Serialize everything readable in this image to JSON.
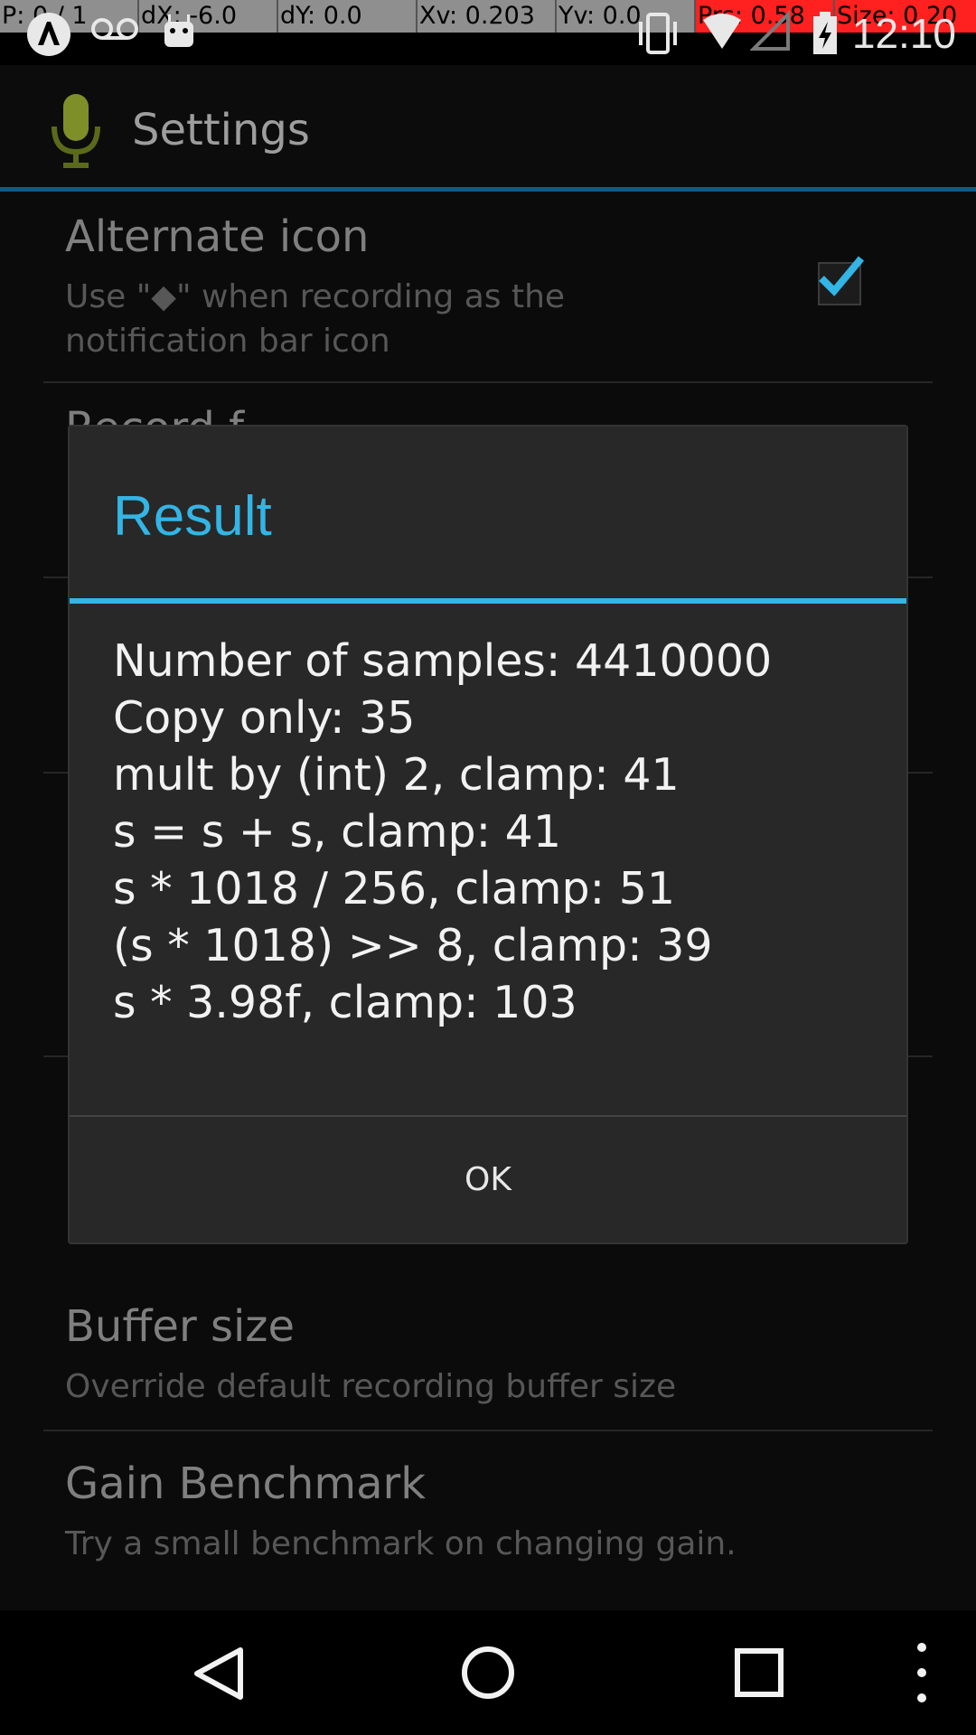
{
  "pointer_overlay": {
    "p": "P: 0 / 1",
    "dx": "dX: -6.0",
    "dy": "dY: 0.0",
    "xv": "Xv: 0.203",
    "yv": "Yv: 0.0",
    "prs": "Prs: 0.58",
    "size": "Size: 0.20"
  },
  "status_bar": {
    "clock": "12:10",
    "icons": [
      "app-notification-icon",
      "voicemail-icon",
      "android-icon",
      "vibrate-icon",
      "wifi-icon",
      "signal-icon",
      "battery-charging-icon"
    ]
  },
  "action_bar": {
    "title": "Settings",
    "icon": "microphone-icon"
  },
  "settings": {
    "alternate_icon": {
      "title": "Alternate icon",
      "summary": "Use \"◆\" when recording as the notification bar icon",
      "checked": true
    },
    "partial_title": "Record f",
    "buffer_size": {
      "title": "Buffer size",
      "summary": "Override default recording buffer size"
    },
    "gain_benchmark": {
      "title": "Gain Benchmark",
      "summary": "Try a small benchmark on changing gain."
    }
  },
  "dialog": {
    "title": "Result",
    "lines": [
      "Number of samples: 4410000",
      "Copy only: 35",
      "mult by (int) 2, clamp: 41",
      "s = s + s, clamp: 41",
      "s * 1018 / 256, clamp: 51",
      "(s * 1018) >> 8, clamp: 39",
      "s * 3.98f, clamp: 103"
    ],
    "ok_label": "OK"
  },
  "nav_bar": {
    "buttons": [
      "back-icon",
      "home-icon",
      "recents-icon",
      "menu-icon"
    ]
  },
  "colors": {
    "accent": "#33b5e5",
    "dialog_bg": "#282828"
  }
}
